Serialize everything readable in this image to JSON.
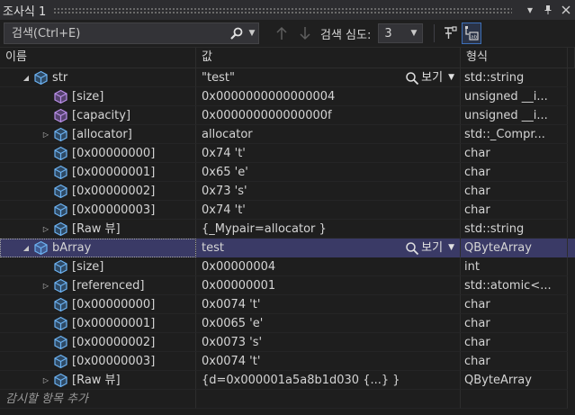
{
  "window": {
    "title": "조사식 1"
  },
  "titlebar": {
    "dropdown_icon": "chevron-down-icon",
    "pin_icon": "pin-icon",
    "close_icon": "close-icon"
  },
  "toolbar": {
    "search_placeholder": "검색(Ctrl+E)",
    "depth_label": "검색 심도:",
    "depth_value": "3"
  },
  "columns": {
    "name": "이름",
    "value": "값",
    "type": "형식"
  },
  "rows": [
    {
      "indent": 0,
      "expander": "expanded",
      "icon": "object",
      "name": "str",
      "value": "\"test\"",
      "visualizer": "보기",
      "type": "std::string",
      "selected": false
    },
    {
      "indent": 1,
      "expander": "none",
      "icon": "purple-field",
      "name": "[size]",
      "value": "0x0000000000000004",
      "type": "unsigned __i...",
      "selected": false
    },
    {
      "indent": 1,
      "expander": "none",
      "icon": "purple-field",
      "name": "[capacity]",
      "value": "0x000000000000000f",
      "type": "unsigned __i...",
      "selected": false
    },
    {
      "indent": 1,
      "expander": "collapsed",
      "icon": "object",
      "name": "[allocator]",
      "value": "allocator",
      "type": "std::_Compr...",
      "selected": false
    },
    {
      "indent": 1,
      "expander": "none",
      "icon": "object",
      "name": "[0x00000000]",
      "value": "0x74 't'",
      "type": "char",
      "selected": false
    },
    {
      "indent": 1,
      "expander": "none",
      "icon": "object",
      "name": "[0x00000001]",
      "value": "0x65 'e'",
      "type": "char",
      "selected": false
    },
    {
      "indent": 1,
      "expander": "none",
      "icon": "object",
      "name": "[0x00000002]",
      "value": "0x73 's'",
      "type": "char",
      "selected": false
    },
    {
      "indent": 1,
      "expander": "none",
      "icon": "object",
      "name": "[0x00000003]",
      "value": "0x74 't'",
      "type": "char",
      "selected": false
    },
    {
      "indent": 1,
      "expander": "collapsed",
      "icon": "object",
      "name": "[Raw 뷰]",
      "value": "{_Mypair=allocator }",
      "type": "std::string",
      "selected": false
    },
    {
      "indent": 0,
      "expander": "expanded",
      "icon": "object",
      "name": "bArray",
      "value": "test",
      "visualizer": "보기",
      "type": "QByteArray",
      "selected": true
    },
    {
      "indent": 1,
      "expander": "none",
      "icon": "object",
      "name": "[size]",
      "value": "0x00000004",
      "type": "int",
      "selected": false
    },
    {
      "indent": 1,
      "expander": "collapsed",
      "icon": "object",
      "name": "[referenced]",
      "value": "0x00000001",
      "type": "std::atomic<...",
      "selected": false
    },
    {
      "indent": 1,
      "expander": "none",
      "icon": "object",
      "name": "[0x00000000]",
      "value": "0x0074 't'",
      "type": "char",
      "selected": false
    },
    {
      "indent": 1,
      "expander": "none",
      "icon": "object",
      "name": "[0x00000001]",
      "value": "0x0065 'e'",
      "type": "char",
      "selected": false
    },
    {
      "indent": 1,
      "expander": "none",
      "icon": "object",
      "name": "[0x00000002]",
      "value": "0x0073 's'",
      "type": "char",
      "selected": false
    },
    {
      "indent": 1,
      "expander": "none",
      "icon": "object",
      "name": "[0x00000003]",
      "value": "0x0074 't'",
      "type": "char",
      "selected": false
    },
    {
      "indent": 1,
      "expander": "collapsed",
      "icon": "object",
      "name": "[Raw 뷰]",
      "value": "{d=0x000001a5a8b1d030 {...} }",
      "type": "QByteArray",
      "selected": false
    }
  ],
  "add_watch": {
    "placeholder": "감시할 항목 추가"
  },
  "colors": {
    "accent": "#3a3a66",
    "object_icon": "#4d9be6",
    "field_icon": "#9a6fd0",
    "text": "#d4d4d4"
  }
}
